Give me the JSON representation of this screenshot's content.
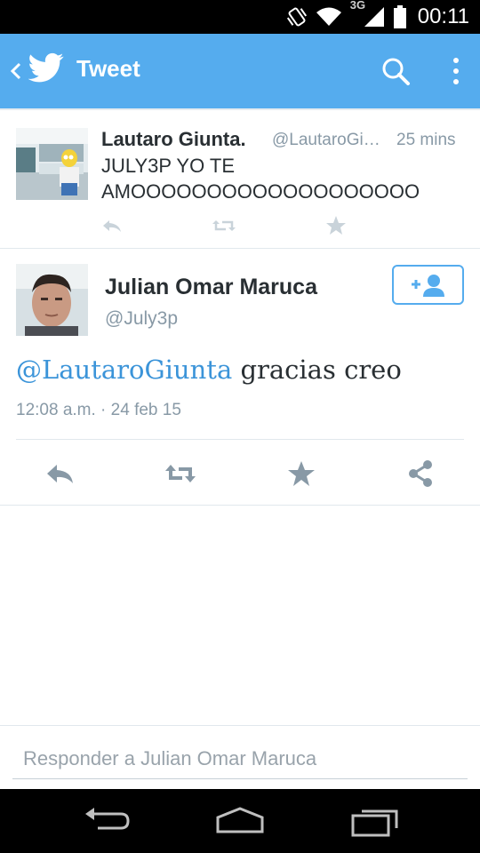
{
  "status_bar": {
    "network": "3G",
    "clock": "00:11",
    "icons": [
      "vibrate-icon",
      "wifi-icon",
      "signal-icon",
      "battery-icon"
    ]
  },
  "action_bar": {
    "title": "Tweet",
    "color": "#55acee",
    "icons": [
      "back-chevron-icon",
      "twitter-bird-icon",
      "search-icon",
      "overflow-menu-icon"
    ]
  },
  "parent_tweet": {
    "name": "Lautaro Giunta.",
    "handle": "@LautaroGiunta",
    "time": "25 mins",
    "text": "JULY3P YO TE AMOOOOOOOOOOOOOOOOOOO",
    "actions": [
      "reply-icon",
      "retweet-icon",
      "favorite-icon"
    ]
  },
  "main_tweet": {
    "name": "Julian Omar Maruca",
    "handle": "@July3p",
    "mention": "@LautaroGiunta",
    "text": " gracias creo",
    "date": "12:08 a.m. · 24 feb 15",
    "follow_icon": "follow-user-icon",
    "actions": [
      "reply-icon",
      "retweet-icon",
      "favorite-icon",
      "share-icon"
    ]
  },
  "reply": {
    "placeholder": "Responder a Julian Omar Maruca"
  },
  "nav_bar": {
    "icons": [
      "back-nav-icon",
      "home-nav-icon",
      "recents-nav-icon"
    ]
  },
  "colors": {
    "accent": "#55acee",
    "mention": "#3b94d9",
    "muted": "#8899a6",
    "text": "#292f33"
  }
}
